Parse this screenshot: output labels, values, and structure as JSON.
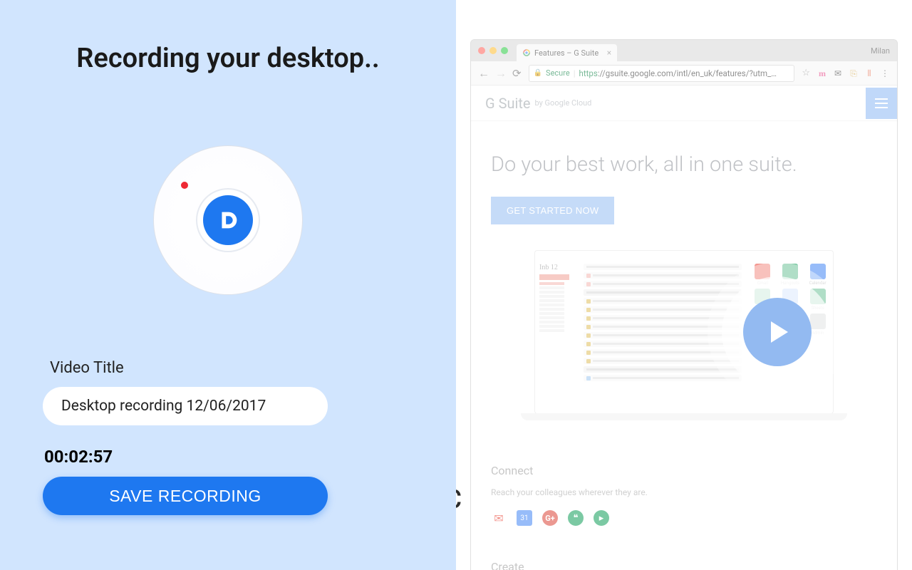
{
  "panel": {
    "title": "Recording your desktop..",
    "video_title_label": "Video Title",
    "video_title_value": "Desktop recording 12/06/2017",
    "timer": "00:02:57",
    "save_label": "SAVE RECORDING"
  },
  "browser": {
    "tab_title": "Features – G Suite",
    "profile": "Milan",
    "secure_label": "Secure",
    "url_https": "https",
    "url_rest": "://gsuite.google.com/intl/en_uk/features/?utm_…"
  },
  "page": {
    "logo": "G Suite",
    "logo_by": "by Google Cloud",
    "hero": "Do your best work, all in one suite.",
    "cta": "GET STARTED NOW",
    "apps": [
      {
        "label": "Gmail",
        "color": "#ea4335"
      },
      {
        "label": "Hangouts",
        "color": "#0f9d58"
      },
      {
        "label": "Calendar",
        "color": "#4285f4"
      },
      {
        "label": "Drive",
        "color": "#0f9d58"
      },
      {
        "label": "Docs",
        "color": "#4285f4"
      },
      {
        "label": "Sheets",
        "color": "#0f9d58"
      },
      {
        "label": "",
        "color": "#a142f4"
      },
      {
        "label": "",
        "color": "#fbbc04"
      },
      {
        "label": "Admin",
        "color": "#5f6368"
      }
    ],
    "connect_title": "Connect",
    "connect_text": "Reach your colleagues wherever they are.",
    "create_title": "Create"
  },
  "hidden_right": "CC"
}
